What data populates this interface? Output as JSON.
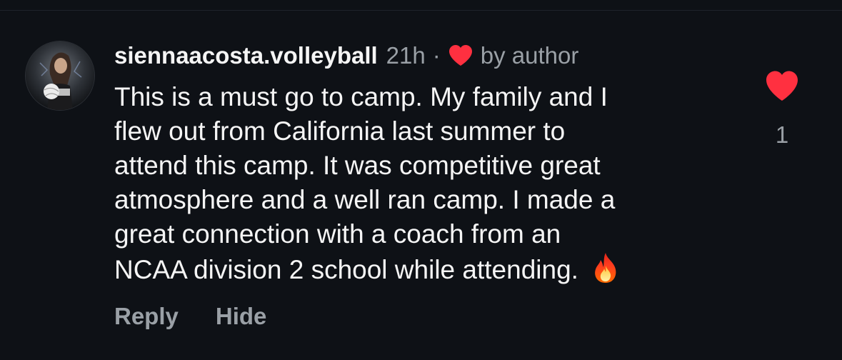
{
  "comment": {
    "username": "siennaacosta.volleyball",
    "timestamp": "21h",
    "separator": "·",
    "liked_by_author_label": "by author",
    "body_lines": [
      "This is a must go to camp. My family and I",
      "flew out from California last summer to",
      "attend this camp. It was competitive great",
      "atmosphere and a well ran camp. I made a",
      "great connection with a coach from an",
      "NCAA division 2 school while attending."
    ],
    "trailing_emoji": "fire-icon",
    "like_count": "1",
    "liked": true
  },
  "actions": {
    "reply_label": "Reply",
    "hide_label": "Hide"
  },
  "colors": {
    "background": "#0e1116",
    "text_primary": "#f5f5f5",
    "text_secondary": "#9aa0a6",
    "heart_red": "#ff3040"
  },
  "icons": {
    "author_like": "heart-icon",
    "like_button": "heart-icon",
    "emoji": "fire-icon"
  }
}
